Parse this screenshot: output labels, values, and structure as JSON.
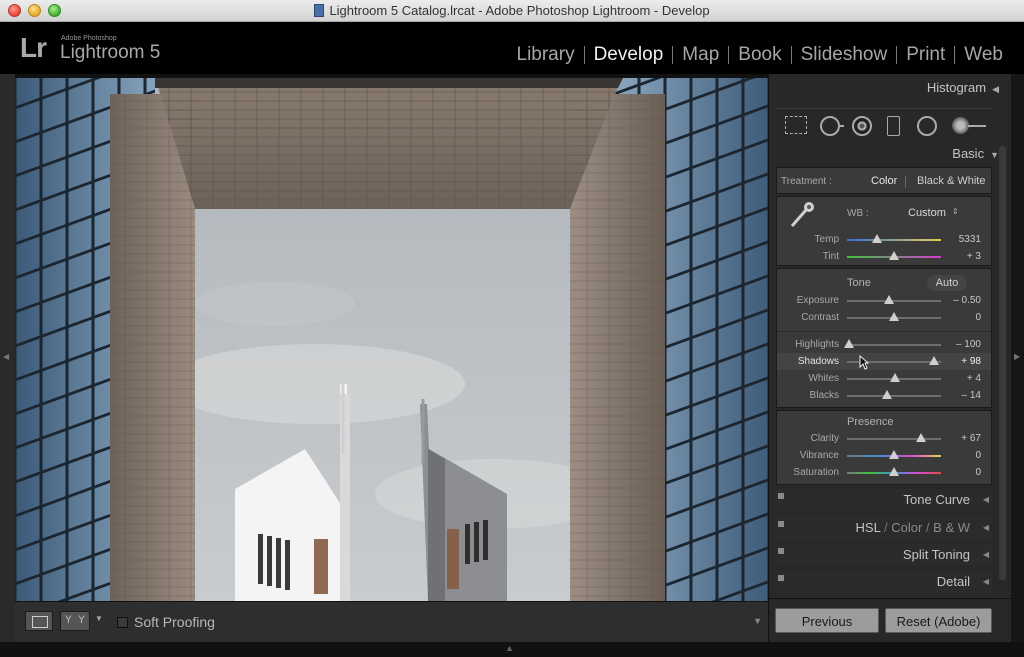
{
  "window": {
    "title": "Lightroom 5 Catalog.lrcat - Adobe Photoshop Lightroom - Develop"
  },
  "identity_plate": {
    "logo": "Lr",
    "adobe_label": "Adobe Photoshop",
    "product": "Lightroom 5"
  },
  "modules": [
    {
      "label": "Library",
      "active": false
    },
    {
      "label": "Develop",
      "active": true
    },
    {
      "label": "Map",
      "active": false
    },
    {
      "label": "Book",
      "active": false
    },
    {
      "label": "Slideshow",
      "active": false
    },
    {
      "label": "Print",
      "active": false
    },
    {
      "label": "Web",
      "active": false
    }
  ],
  "right_panel": {
    "histogram_title": "Histogram",
    "tools": [
      "crop-overlay-icon",
      "spot-removal-icon",
      "red-eye-icon",
      "graduated-filter-icon",
      "radial-filter-icon",
      "adjustment-brush-icon"
    ],
    "basic_title": "Basic",
    "treatment_label": "Treatment :",
    "treatment_color": "Color",
    "treatment_bw": "Black & White",
    "wb_label": "WB :",
    "wb_value": "Custom",
    "temp": {
      "label": "Temp",
      "value": "5331",
      "position": 0.32
    },
    "tint": {
      "label": "Tint",
      "value": "+ 3",
      "position": 0.5
    },
    "tone_label": "Tone",
    "auto_label": "Auto",
    "exposure": {
      "label": "Exposure",
      "value": "– 0.50",
      "position": 0.45
    },
    "contrast": {
      "label": "Contrast",
      "value": "0",
      "position": 0.5
    },
    "highlights": {
      "label": "Highlights",
      "value": "– 100",
      "position": 0.02
    },
    "shadows": {
      "label": "Shadows",
      "value": "+ 98",
      "position": 0.93
    },
    "whites": {
      "label": "Whites",
      "value": "+ 4",
      "position": 0.51
    },
    "blacks": {
      "label": "Blacks",
      "value": "– 14",
      "position": 0.43
    },
    "presence_label": "Presence",
    "clarity": {
      "label": "Clarity",
      "value": "+ 67",
      "position": 0.79
    },
    "vibrance": {
      "label": "Vibrance",
      "value": "0",
      "position": 0.5
    },
    "saturation": {
      "label": "Saturation",
      "value": "0",
      "position": 0.5
    },
    "tone_curve": "Tone Curve",
    "hsl_hsl": "HSL",
    "hsl_color": "Color",
    "hsl_bw": "B & W",
    "hsl_sep": "/",
    "split_toning": "Split Toning",
    "detail": "Detail",
    "previous_button": "Previous",
    "reset_button": "Reset (Adobe)"
  },
  "toolbar": {
    "soft_proofing": "Soft Proofing",
    "view_yy": "Y Y"
  },
  "colors": {
    "panel_bg": "#282828",
    "section_bg": "#3a3a3a",
    "active_module": "#f0f0f0",
    "temp_gradient": [
      "#3a6cd6",
      "#e6d24a"
    ],
    "tint_gradient": [
      "#3fc33f",
      "#d23fd2"
    ]
  }
}
